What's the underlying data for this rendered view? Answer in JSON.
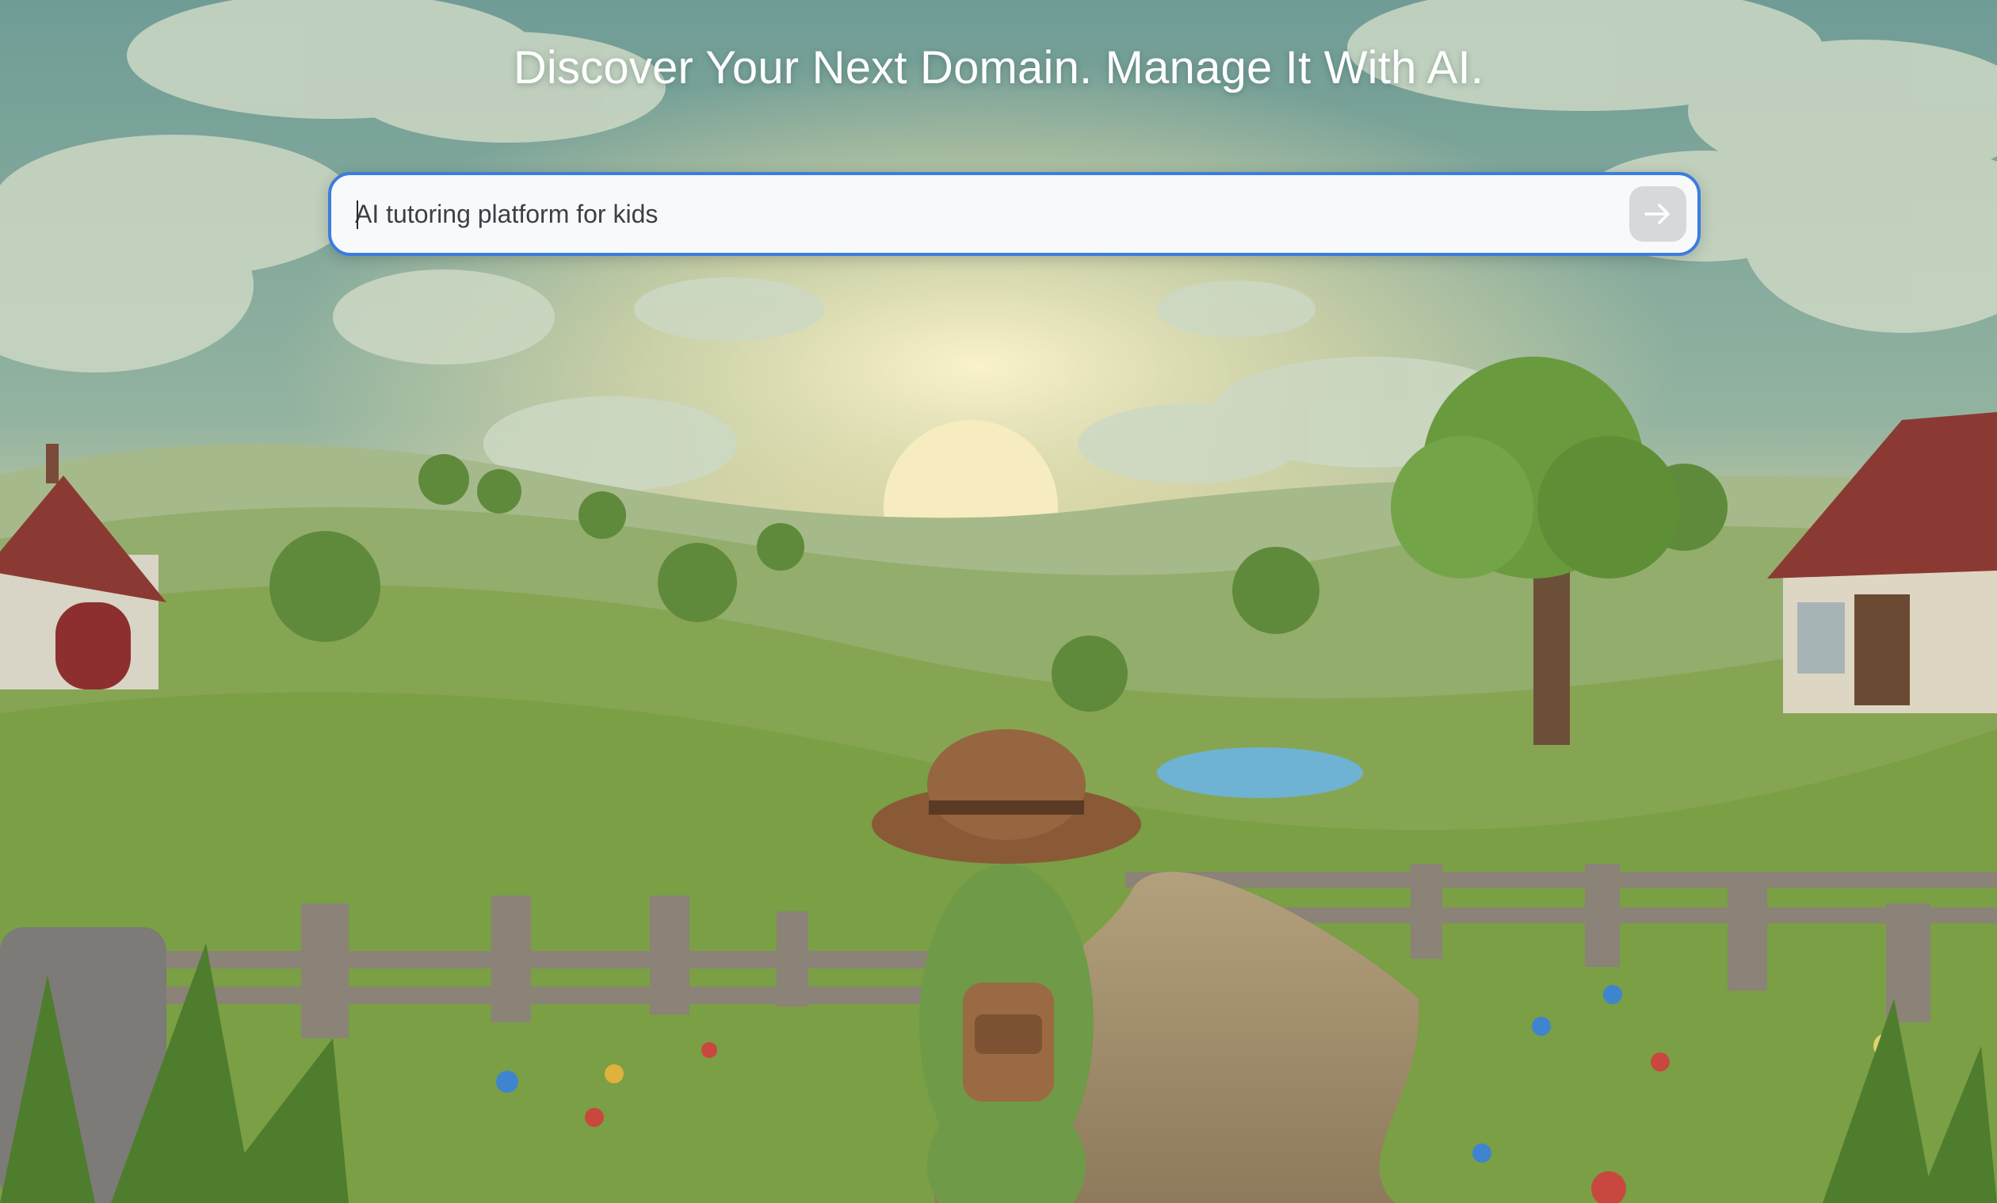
{
  "hero": {
    "title": "Discover Your Next Domain. Manage It With AI."
  },
  "search": {
    "value": "AI tutoring platform for kids",
    "submit_icon": "arrow-right-icon"
  },
  "background": {
    "scene": "illustration",
    "colors": {
      "sky": "#7ea79f",
      "sun_glow": "#f4e3a8",
      "hills": "#7fa64a",
      "path": "#9c8a6c"
    }
  }
}
